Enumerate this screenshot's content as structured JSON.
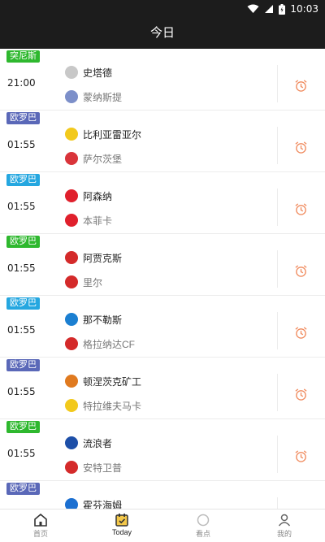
{
  "status_bar": {
    "time": "10:03"
  },
  "header": {
    "title": "今日"
  },
  "matches": [
    {
      "league": "突尼斯",
      "league_color": "#2eb82e",
      "time": "21:00",
      "home": "史塔德",
      "away": "蒙纳斯提",
      "home_logo_color": "#c8c8c8",
      "away_logo_color": "#7c8fc9"
    },
    {
      "league": "欧罗巴",
      "league_color": "#5a68b8",
      "time": "01:55",
      "home": "比利亚雷亚尔",
      "away": "萨尔茨堡",
      "home_logo_color": "#f2c91c",
      "away_logo_color": "#d9343a"
    },
    {
      "league": "欧罗巴",
      "league_color": "#25a7e0",
      "time": "01:55",
      "home": "阿森纳",
      "away": "本菲卡",
      "home_logo_color": "#e0202c",
      "away_logo_color": "#e0202c"
    },
    {
      "league": "欧罗巴",
      "league_color": "#2eb82e",
      "time": "01:55",
      "home": "阿贾克斯",
      "away": "里尔",
      "home_logo_color": "#d42a2a",
      "away_logo_color": "#d42a2a"
    },
    {
      "league": "欧罗巴",
      "league_color": "#25a7e0",
      "time": "01:55",
      "home": "那不勒斯",
      "away": "格拉纳达CF",
      "home_logo_color": "#1b7fd1",
      "away_logo_color": "#d42a2a"
    },
    {
      "league": "欧罗巴",
      "league_color": "#5a68b8",
      "time": "01:55",
      "home": "顿涅茨克矿工",
      "away": "特拉维夫马卡",
      "home_logo_color": "#e07a1f",
      "away_logo_color": "#f2c91c"
    },
    {
      "league": "欧罗巴",
      "league_color": "#2eb82e",
      "time": "01:55",
      "home": "流浪者",
      "away": "安特卫普",
      "home_logo_color": "#1d4fa8",
      "away_logo_color": "#d42a2a"
    },
    {
      "league": "欧罗巴",
      "league_color": "#5a68b8",
      "time": "",
      "home": "霍芬海姆",
      "away": "",
      "home_logo_color": "#1b6fd1",
      "away_logo_color": "#ffffff"
    }
  ],
  "tabs": [
    {
      "label": "首页",
      "icon": "home-icon"
    },
    {
      "label": "Today",
      "icon": "calendar-icon"
    },
    {
      "label": "看点",
      "icon": "highlight-icon"
    },
    {
      "label": "我的",
      "icon": "profile-icon"
    }
  ],
  "colors": {
    "alarm": "#f08a5d",
    "header_bg": "#1c1c1c"
  }
}
